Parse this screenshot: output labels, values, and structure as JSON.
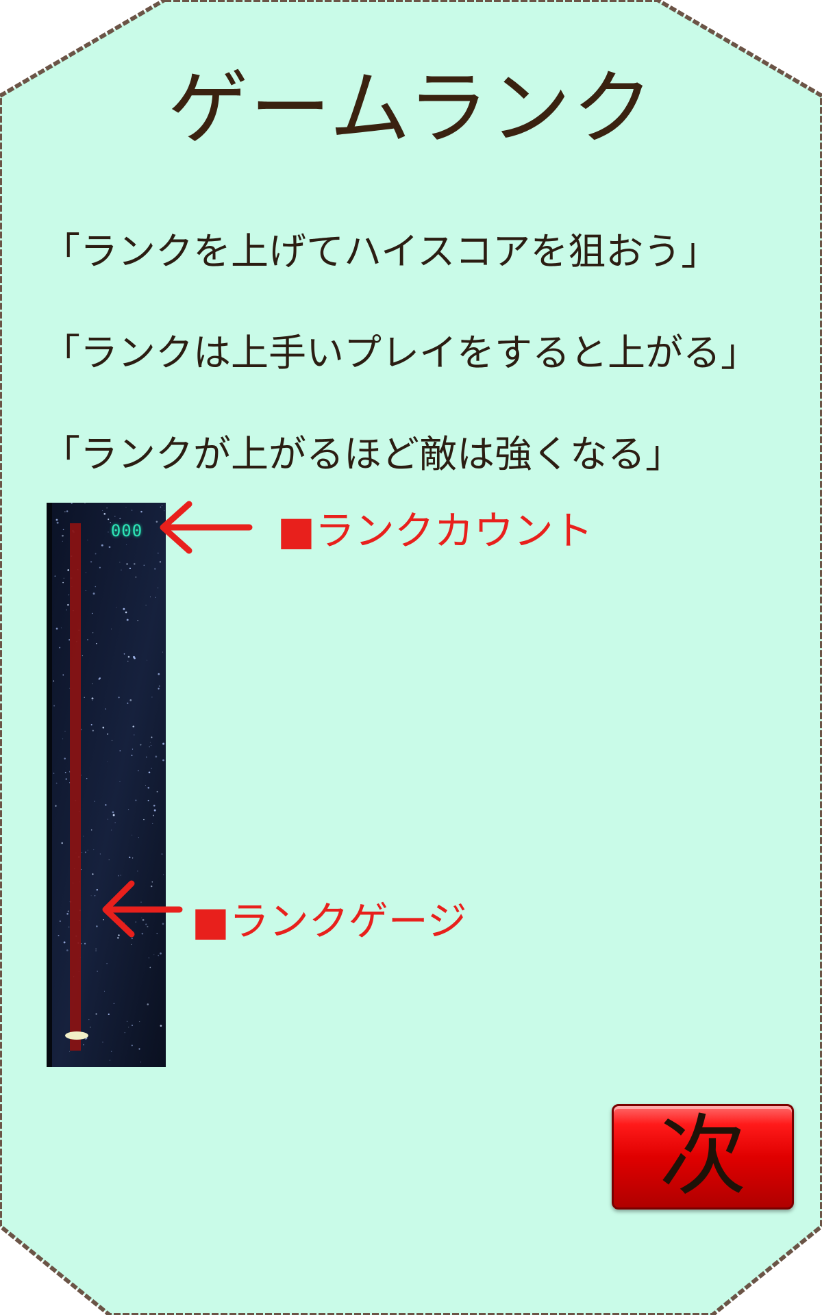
{
  "screen": {
    "title": "ゲームランク",
    "lines": [
      "「ランクを上げてハイスコアを狙おう」",
      "「ランクは上手いプレイをすると上がる」",
      "「ランクが上がるほど敵は強くなる」"
    ]
  },
  "game_preview": {
    "rank_count": "000",
    "rank_gauge_fill": 0.0
  },
  "callouts": {
    "rank_count": "■ランクカウント",
    "rank_gauge": "■ランクゲージ"
  },
  "next_button": {
    "label": "次"
  },
  "colors": {
    "background": "#c9fbe8",
    "frame_border": "#6b5446",
    "callout": "#e8201c",
    "gauge": "#8b1212",
    "next_button": "#e00000"
  }
}
